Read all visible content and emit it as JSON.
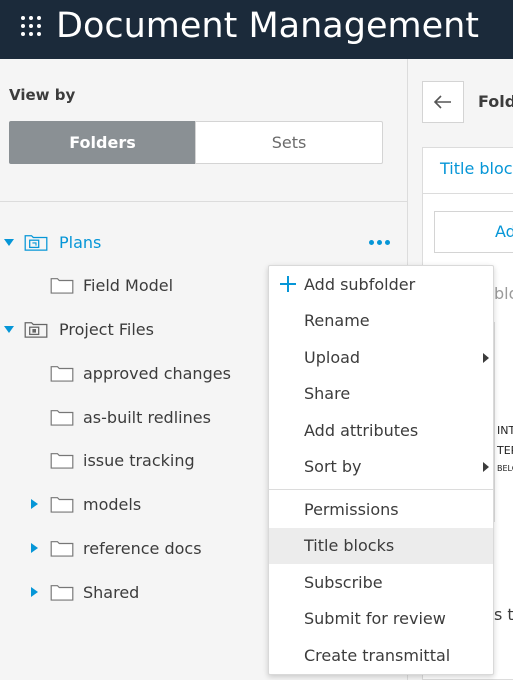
{
  "header": {
    "title": "Document Management",
    "icon": "app-grid-icon"
  },
  "sidebar": {
    "view_by_label": "View by",
    "view_toggle": {
      "folders": "Folders",
      "sets": "Sets",
      "selected": "Folders"
    },
    "tree": [
      {
        "label": "Plans",
        "icon": "plans-folder-icon",
        "expanded": true,
        "active": true
      },
      {
        "label": "Field Model",
        "icon": "folder-icon"
      },
      {
        "label": "Project Files",
        "icon": "project-files-icon",
        "expanded": true
      },
      {
        "label": "approved changes",
        "icon": "folder-icon"
      },
      {
        "label": "as-built redlines",
        "icon": "folder-icon"
      },
      {
        "label": "issue tracking",
        "icon": "folder-icon"
      },
      {
        "label": "models",
        "icon": "folder-icon",
        "expandable": true
      },
      {
        "label": "reference docs",
        "icon": "folder-icon",
        "expandable": true
      },
      {
        "label": "Shared",
        "icon": "folder-icon",
        "expandable": true
      }
    ]
  },
  "context_menu": {
    "items": [
      {
        "label": "Add subfolder",
        "icon": "plus-icon"
      },
      {
        "label": "Rename"
      },
      {
        "label": "Upload",
        "submenu": true
      },
      {
        "label": "Share"
      },
      {
        "label": "Add attributes"
      },
      {
        "label": "Sort by",
        "submenu": true
      },
      {
        "label": "Permissions"
      },
      {
        "label": "Title blocks",
        "hovered": true
      },
      {
        "label": "Subscribe"
      },
      {
        "label": "Submit for review"
      },
      {
        "label": "Create transmittal"
      }
    ]
  },
  "right_panel": {
    "title": "Fold",
    "tab": "Title block",
    "add_button": "Ad",
    "peek_text_1": "blo",
    "peek_text_2": "s th",
    "thumb_lines": [
      "INT",
      "TER",
      "BELO"
    ]
  },
  "colors": {
    "accent": "#0696d7",
    "header_bg": "#1b2a3a",
    "toggle_selected": "#8a9094"
  }
}
